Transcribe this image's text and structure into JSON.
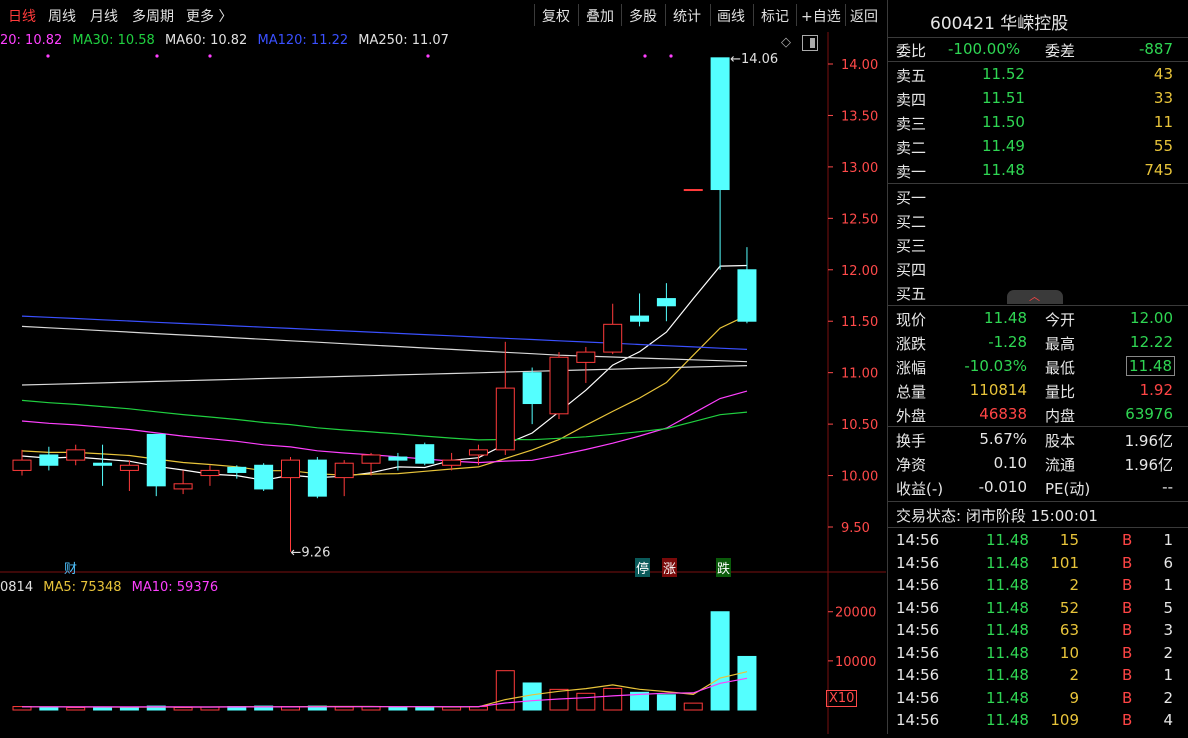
{
  "toolbar": {
    "left_tabs": [
      "日线",
      "周线",
      "月线",
      "多周期",
      "更多 〉"
    ],
    "right_buttons": [
      "复权",
      "叠加",
      "多股",
      "统计",
      "画线",
      "标记",
      "+自选",
      "返回"
    ]
  },
  "price_chart": {
    "ma_legend": [
      {
        "text": "20: 10.82",
        "color": "#ff40ff"
      },
      {
        "text": "MA30: 10.58",
        "color": "#20d040"
      },
      {
        "text": "MA60: 10.82",
        "color": "#e0e0e0"
      },
      {
        "text": "MA120: 11.22",
        "color": "#3a50ff"
      },
      {
        "text": "MA250: 11.07",
        "color": "#e0e0e0"
      }
    ],
    "high_annotation": "14.06",
    "low_annotation": "9.26",
    "markers": [
      {
        "text": "财",
        "bg": "#000000",
        "color": "#4fc3ff"
      },
      {
        "text": "停",
        "bg": "#0a5a5a",
        "color": "#ffffff"
      },
      {
        "text": "涨",
        "bg": "#7a0a0a",
        "color": "#ffffff"
      },
      {
        "text": "跌",
        "bg": "#0a5a0a",
        "color": "#ffffff"
      }
    ],
    "y_ticks": [
      "14.00",
      "13.50",
      "13.00",
      "12.50",
      "12.00",
      "11.50",
      "11.00",
      "10.50",
      "10.00",
      "9.50"
    ]
  },
  "volume_chart": {
    "legend": [
      {
        "text": "0814",
        "color": "#e0e0e0"
      },
      {
        "text": "MA5: 75348",
        "color": "#e8c43a"
      },
      {
        "text": "MA10: 59376",
        "color": "#ff40ff"
      }
    ],
    "y_ticks": [
      "20000",
      "10000"
    ],
    "unit": "X10"
  },
  "chart_data": {
    "type": "candlestick",
    "ylim": [
      9.25,
      14.3
    ],
    "candles": [
      {
        "o": 10.05,
        "c": 10.15,
        "h": 10.25,
        "l": 10.0
      },
      {
        "o": 10.2,
        "c": 10.1,
        "h": 10.28,
        "l": 10.05
      },
      {
        "o": 10.15,
        "c": 10.25,
        "h": 10.3,
        "l": 10.1
      },
      {
        "o": 10.12,
        "c": 10.1,
        "h": 10.3,
        "l": 9.9
      },
      {
        "o": 10.05,
        "c": 10.1,
        "h": 10.15,
        "l": 9.85
      },
      {
        "o": 10.4,
        "c": 9.9,
        "h": 10.4,
        "l": 9.8
      },
      {
        "o": 9.87,
        "c": 9.92,
        "h": 10.05,
        "l": 9.82
      },
      {
        "o": 10.0,
        "c": 10.05,
        "h": 10.1,
        "l": 9.9
      },
      {
        "o": 10.08,
        "c": 10.03,
        "h": 10.1,
        "l": 9.97
      },
      {
        "o": 10.1,
        "c": 9.87,
        "h": 10.12,
        "l": 9.85
      },
      {
        "o": 9.98,
        "c": 10.15,
        "h": 10.18,
        "l": 9.26
      },
      {
        "o": 10.15,
        "c": 9.8,
        "h": 10.18,
        "l": 9.78
      },
      {
        "o": 9.98,
        "c": 10.12,
        "h": 10.15,
        "l": 9.8
      },
      {
        "o": 10.12,
        "c": 10.2,
        "h": 10.22,
        "l": 10.0
      },
      {
        "o": 10.18,
        "c": 10.15,
        "h": 10.22,
        "l": 10.05
      },
      {
        "o": 10.3,
        "c": 10.12,
        "h": 10.32,
        "l": 10.1
      },
      {
        "o": 10.1,
        "c": 10.15,
        "h": 10.22,
        "l": 10.05
      },
      {
        "o": 10.2,
        "c": 10.25,
        "h": 10.3,
        "l": 10.1
      },
      {
        "o": 10.25,
        "c": 10.85,
        "h": 11.3,
        "l": 10.2
      },
      {
        "o": 11.0,
        "c": 10.7,
        "h": 11.05,
        "l": 10.5
      },
      {
        "o": 10.6,
        "c": 11.15,
        "h": 11.2,
        "l": 10.55
      },
      {
        "o": 11.1,
        "c": 11.2,
        "h": 11.25,
        "l": 10.9
      },
      {
        "o": 11.2,
        "c": 11.47,
        "h": 11.67,
        "l": 11.18
      },
      {
        "o": 11.55,
        "c": 11.5,
        "h": 11.77,
        "l": 11.45
      },
      {
        "o": 11.72,
        "c": 11.65,
        "h": 11.87,
        "l": 11.5
      },
      {
        "o": 12.78,
        "c": 12.78,
        "h": 12.78,
        "l": 12.78
      },
      {
        "o": 14.06,
        "c": 12.78,
        "h": 14.06,
        "l": 12.0
      },
      {
        "o": 12.0,
        "c": 11.5,
        "h": 12.22,
        "l": 11.48
      }
    ],
    "volume_ylim": [
      0,
      23000
    ],
    "volumes": [
      {
        "v": 700,
        "up": true
      },
      {
        "v": 600,
        "up": false
      },
      {
        "v": 500,
        "up": true
      },
      {
        "v": 600,
        "up": false
      },
      {
        "v": 600,
        "up": false
      },
      {
        "v": 800,
        "up": false
      },
      {
        "v": 500,
        "up": true
      },
      {
        "v": 600,
        "up": true
      },
      {
        "v": 700,
        "up": false
      },
      {
        "v": 800,
        "up": false
      },
      {
        "v": 700,
        "up": true
      },
      {
        "v": 800,
        "up": false
      },
      {
        "v": 600,
        "up": true
      },
      {
        "v": 700,
        "up": true
      },
      {
        "v": 600,
        "up": false
      },
      {
        "v": 700,
        "up": false
      },
      {
        "v": 600,
        "up": true
      },
      {
        "v": 700,
        "up": true
      },
      {
        "v": 8000,
        "up": true
      },
      {
        "v": 5500,
        "up": false
      },
      {
        "v": 4200,
        "up": true
      },
      {
        "v": 3400,
        "up": true
      },
      {
        "v": 4400,
        "up": true
      },
      {
        "v": 3600,
        "up": false
      },
      {
        "v": 3100,
        "up": false
      },
      {
        "v": 1400,
        "up": true
      },
      {
        "v": 20000,
        "up": false
      },
      {
        "v": 10900,
        "up": false
      }
    ]
  },
  "quote": {
    "header": "600421 华嵘控股",
    "weibi_label": "委比",
    "weibi_value": "-100.00%",
    "weicha_label": "委差",
    "weicha_value": "-887",
    "asks": [
      {
        "label": "卖五",
        "price": "11.52",
        "vol": "43"
      },
      {
        "label": "卖四",
        "price": "11.51",
        "vol": "33"
      },
      {
        "label": "卖三",
        "price": "11.50",
        "vol": "11"
      },
      {
        "label": "卖二",
        "price": "11.49",
        "vol": "55"
      },
      {
        "label": "卖一",
        "price": "11.48",
        "vol": "745"
      }
    ],
    "bids": [
      "买一",
      "买二",
      "买三",
      "买四",
      "买五"
    ],
    "stats": [
      {
        "l1": "现价",
        "v1": "11.48",
        "c1": "g",
        "l2": "今开",
        "v2": "12.00",
        "c2": "g"
      },
      {
        "l1": "涨跌",
        "v1": "-1.28",
        "c1": "g",
        "l2": "最高",
        "v2": "12.22",
        "c2": "g"
      },
      {
        "l1": "涨幅",
        "v1": "-10.03%",
        "c1": "g",
        "l2": "最低",
        "v2": "11.48",
        "c2": "g"
      },
      {
        "l1": "总量",
        "v1": "110814",
        "c1": "y",
        "l2": "量比",
        "v2": "1.92",
        "c2": "r"
      },
      {
        "l1": "外盘",
        "v1": "46838",
        "c1": "r",
        "l2": "内盘",
        "v2": "63976",
        "c2": "g"
      }
    ],
    "fundamentals": [
      {
        "l1": "换手",
        "v1": "5.67%",
        "l2": "股本",
        "v2": "1.96亿"
      },
      {
        "l1": "净资",
        "v1": "0.10",
        "l2": "流通",
        "v2": "1.96亿"
      },
      {
        "l1": "收益(-)",
        "v1": "-0.010",
        "l2": "PE(动)",
        "v2": "--"
      }
    ],
    "status": "交易状态: 闭市阶段 15:00:01",
    "ticks": [
      {
        "t": "14:56",
        "p": "11.48",
        "v": "15",
        "bs": "B",
        "n": "1"
      },
      {
        "t": "14:56",
        "p": "11.48",
        "v": "101",
        "bs": "B",
        "n": "6"
      },
      {
        "t": "14:56",
        "p": "11.48",
        "v": "2",
        "bs": "B",
        "n": "1"
      },
      {
        "t": "14:56",
        "p": "11.48",
        "v": "52",
        "bs": "B",
        "n": "5"
      },
      {
        "t": "14:56",
        "p": "11.48",
        "v": "63",
        "bs": "B",
        "n": "3"
      },
      {
        "t": "14:56",
        "p": "11.48",
        "v": "10",
        "bs": "B",
        "n": "2"
      },
      {
        "t": "14:56",
        "p": "11.48",
        "v": "2",
        "bs": "B",
        "n": "1"
      },
      {
        "t": "14:56",
        "p": "11.48",
        "v": "9",
        "bs": "B",
        "n": "2"
      },
      {
        "t": "14:56",
        "p": "11.48",
        "v": "109",
        "bs": "B",
        "n": "4"
      }
    ]
  },
  "colors": {
    "up": "#ff3b3b",
    "down": "#54ffff",
    "ma5": "#ffffff",
    "ma10": "#e8c43a",
    "ma20": "#ff40ff",
    "ma30": "#20d040",
    "ma120": "#3a50ff"
  }
}
